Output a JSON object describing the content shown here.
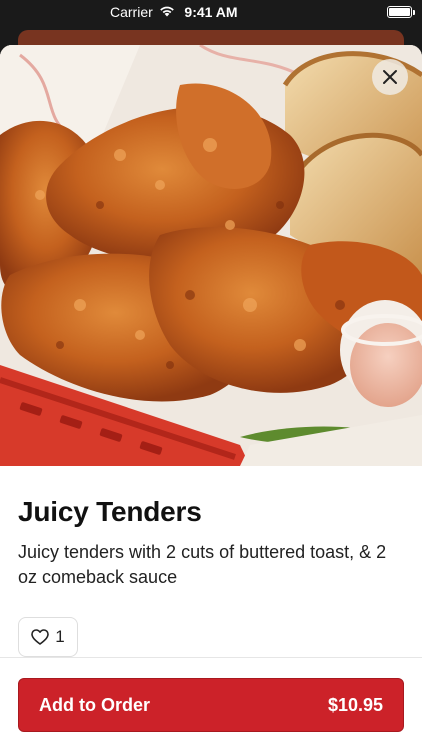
{
  "status_bar": {
    "carrier": "Carrier",
    "time": "9:41 AM"
  },
  "item": {
    "title": "Juicy Tenders",
    "description": "Juicy tenders with 2 cuts of buttered toast, & 2 oz comeback sauce",
    "likes": "1",
    "image_alt": "Fried chicken tenders with toast and dipping sauce in a red basket"
  },
  "order": {
    "label": "Add to Order",
    "price": "$10.95"
  },
  "colors": {
    "accent": "#cc2229",
    "text": "#111111",
    "border": "#dedede"
  },
  "icons": {
    "close": "close-icon",
    "like": "heart-icon",
    "wifi": "wifi-icon",
    "battery": "battery-icon"
  }
}
